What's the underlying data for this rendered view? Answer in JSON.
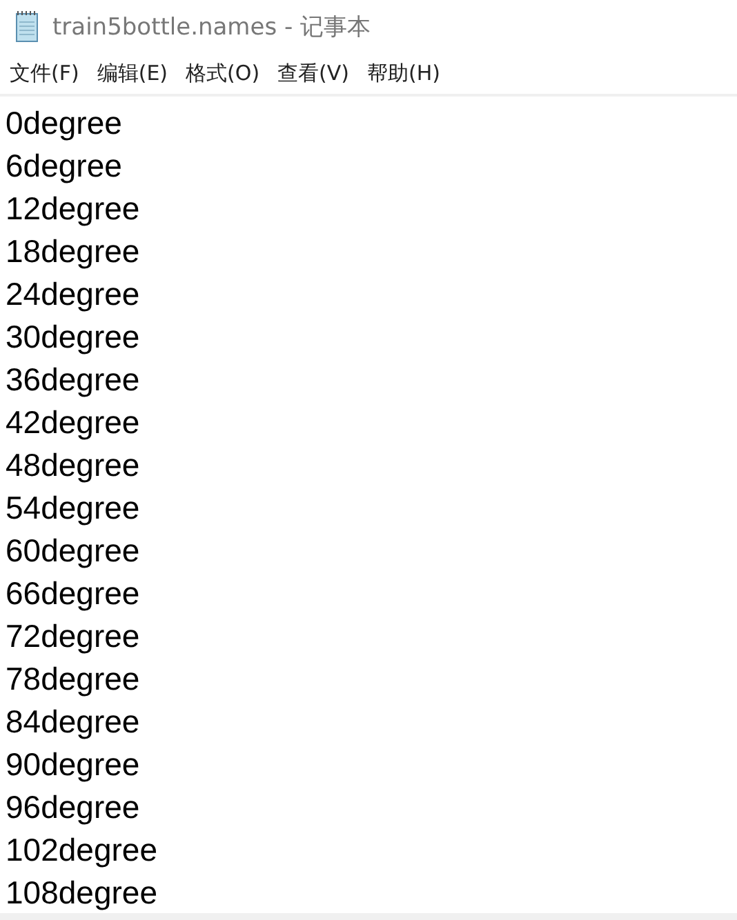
{
  "window": {
    "title": "train5bottle.names - 记事本"
  },
  "menu": [
    "文件(F)",
    "编辑(E)",
    "格式(O)",
    "查看(V)",
    "帮助(H)"
  ],
  "lines": [
    "0degree",
    "6degree",
    "12degree",
    "18degree",
    "24degree",
    "30degree",
    "36degree",
    "42degree",
    "48degree",
    "54degree",
    "60degree",
    "66degree",
    "72degree",
    "78degree",
    "84degree",
    "90degree",
    "96degree",
    "102degree",
    "108degree"
  ]
}
